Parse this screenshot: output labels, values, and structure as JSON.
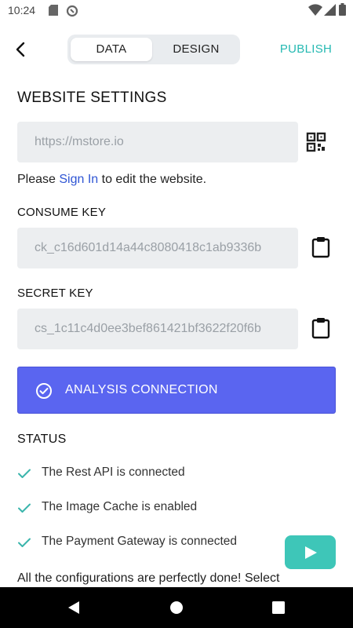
{
  "status_bar": {
    "time": "10:24",
    "icons": [
      "sd-card-icon",
      "sync-icon",
      "wifi-icon",
      "signal-icon",
      "battery-icon"
    ]
  },
  "header": {
    "tabs": [
      {
        "label": "DATA",
        "active": true
      },
      {
        "label": "DESIGN",
        "active": false
      }
    ],
    "publish_label": "PUBLISH",
    "accent_color": "#25b9b2"
  },
  "website_settings": {
    "title": "WEBSITE SETTINGS",
    "url_placeholder": "https://mstore.io",
    "signin_prefix": "Please ",
    "signin_link": "Sign In",
    "signin_suffix": " to edit the website.",
    "consume_key_label": "CONSUME KEY",
    "consume_key_value": "ck_c16d601d14a44c8080418c1ab9336b",
    "secret_key_label": "SECRET KEY",
    "secret_key_value": "cs_1c11c4d0ee3bef861421bf3622f20f6b"
  },
  "analysis_button": {
    "label": "ANALYSIS CONNECTION",
    "color": "#5a65f0"
  },
  "status": {
    "title": "STATUS",
    "items": [
      "The Rest API is connected",
      "The Image Cache is enabled",
      "The Payment Gateway is connected"
    ],
    "tick_color": "#3ab5ac"
  },
  "footer_text": "All the configurations are perfectly done! Select",
  "play_button_color": "#3ec6b8"
}
